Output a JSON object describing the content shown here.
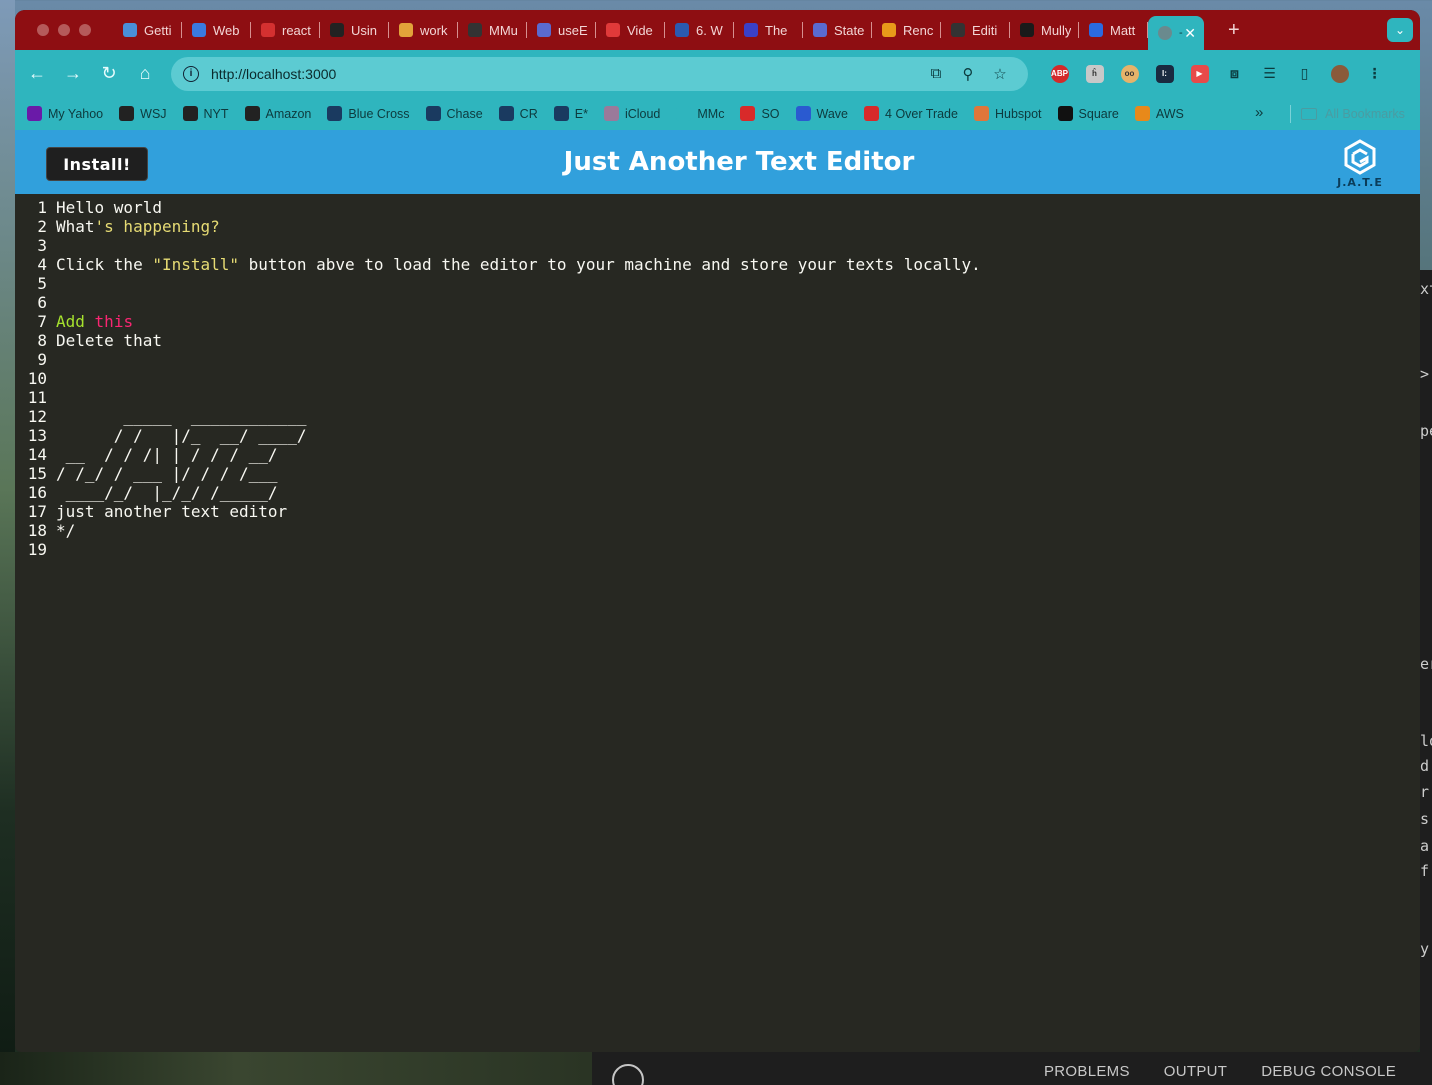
{
  "browser": {
    "tabs": [
      {
        "label": "Getti",
        "fav": "#4a8ed8",
        "icon": "gear-icon"
      },
      {
        "label": "Web",
        "fav": "#3a7ae0",
        "icon": "bolt-icon"
      },
      {
        "label": "react",
        "fav": "#d43030",
        "icon": "bookmark-icon"
      },
      {
        "label": "Usin",
        "fav": "#222222",
        "icon": "medium-icon"
      },
      {
        "label": "work",
        "fav": "#e2a33a",
        "icon": "chrome-icon"
      },
      {
        "label": "MMu",
        "fav": "#333333",
        "icon": "github-icon"
      },
      {
        "label": "useE",
        "fav": "#5a6ad0",
        "icon": "react-icon"
      },
      {
        "label": "Vide",
        "fav": "#e03a3a",
        "icon": "video-icon"
      },
      {
        "label": "6. W",
        "fav": "#2a5ab0",
        "icon": "ucla-icon"
      },
      {
        "label": "The",
        "fav": "#3a40c8",
        "icon": "shield-icon"
      },
      {
        "label": "State",
        "fav": "#5a6ad0",
        "icon": "react-icon"
      },
      {
        "label": "Renc",
        "fav": "#e89a1a",
        "icon": "fs-icon"
      },
      {
        "label": "Editi",
        "fav": "#333333",
        "icon": "github-icon"
      },
      {
        "label": "Mully",
        "fav": "#1a1a1a",
        "icon": "person-icon"
      },
      {
        "label": "Matt",
        "fav": "#2a6ae0",
        "icon": "zoom-icon"
      }
    ],
    "active_tab": {
      "label": "-",
      "close": "✕"
    },
    "new_tab": "+",
    "url": "http://localhost:3000",
    "bookmarks": [
      {
        "label": "My Yahoo",
        "color": "#6a1aa8"
      },
      {
        "label": "WSJ",
        "color": "#222222"
      },
      {
        "label": "NYT",
        "color": "#222222"
      },
      {
        "label": "Amazon",
        "color": "#222222"
      },
      {
        "label": "Blue Cross",
        "color": "#1a3a60"
      },
      {
        "label": "Chase",
        "color": "#1a3a60"
      },
      {
        "label": "CR",
        "color": "#1a3a60"
      },
      {
        "label": "E*",
        "color": "#1a3a60"
      },
      {
        "label": "iCloud",
        "color": "#9a7a9a"
      },
      {
        "label": "MMc",
        "color": "#2fb5be"
      },
      {
        "label": "SO",
        "color": "#d82a2a"
      },
      {
        "label": "Wave",
        "color": "#2a5ad0"
      },
      {
        "label": "4 Over Trade",
        "color": "#d82a2a"
      },
      {
        "label": "Hubspot",
        "color": "#e0763a"
      },
      {
        "label": "Square",
        "color": "#111111"
      },
      {
        "label": "AWS",
        "color": "#e8891a"
      }
    ],
    "all_bookmarks": "All Bookmarks",
    "more_bookmarks": "»"
  },
  "app": {
    "install_label": "Install!",
    "title": "Just Another Text Editor",
    "logo_text": "J.A.T.E"
  },
  "editor": {
    "lines": [
      {
        "n": "1",
        "text": "Hello world"
      },
      {
        "n": "2",
        "text": "What's happening?"
      },
      {
        "n": "3",
        "text": ""
      },
      {
        "n": "4",
        "text": "Click the \"Install\" button abve to load the editor to your machine and store your texts locally."
      },
      {
        "n": "5",
        "text": ""
      },
      {
        "n": "6",
        "text": ""
      },
      {
        "n": "7",
        "text": "Add this"
      },
      {
        "n": "8",
        "text": "Delete that"
      },
      {
        "n": "9",
        "text": ""
      },
      {
        "n": "10",
        "text": ""
      },
      {
        "n": "11",
        "text": ""
      },
      {
        "n": "12",
        "text": "       _____  ____________"
      },
      {
        "n": "13",
        "text": "      / /   |/_  __/ ____/"
      },
      {
        "n": "14",
        "text": " __  / / /| | / / / __/"
      },
      {
        "n": "15",
        "text": "/ /_/ / ___ |/ / / /___"
      },
      {
        "n": "16",
        "text": " ____/_/  |_/_/ /_____/"
      },
      {
        "n": "17",
        "text": "just another text editor"
      },
      {
        "n": "18",
        "text": "*/"
      },
      {
        "n": "19",
        "text": ""
      }
    ]
  },
  "vscode": {
    "panel_tabs": [
      "PROBLEMS",
      "OUTPUT",
      "DEBUG CONSOLE"
    ],
    "side_fragments": [
      "xt",
      ">",
      "pe",
      "er",
      "lo",
      "d",
      "r",
      "s",
      "a",
      "f",
      "y"
    ]
  }
}
